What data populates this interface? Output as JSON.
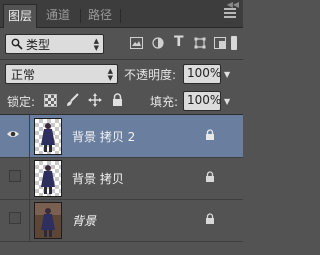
{
  "tabs": [
    {
      "label": "图层",
      "active": true
    },
    {
      "label": "通道",
      "active": false
    },
    {
      "label": "路径",
      "active": false
    }
  ],
  "filter": {
    "kind_label": "类型"
  },
  "blend": {
    "mode": "正常",
    "opacity_label": "不透明度:",
    "opacity_value": "100%"
  },
  "lock": {
    "label": "锁定:",
    "fill_label": "填充:",
    "fill_value": "100%"
  },
  "layers": [
    {
      "name": "背景 拷贝 2",
      "visible": true,
      "selected": true
    },
    {
      "name": "背景 拷贝",
      "visible": false,
      "selected": false
    },
    {
      "name": "背景",
      "visible": false,
      "selected": false,
      "italic": true
    }
  ],
  "colors": {
    "selection": "#6a7fa0",
    "panel": "#535353"
  }
}
